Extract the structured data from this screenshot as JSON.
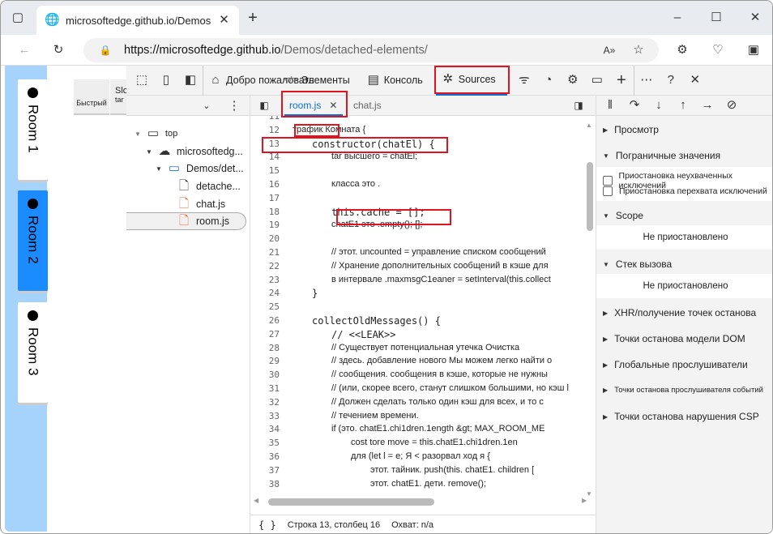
{
  "browser": {
    "tab_title": "microsoftedge.github.io/Demos/d",
    "url_host": "https://microsoftedge.github.io",
    "url_path": "/Demos/detached-elements/"
  },
  "page": {
    "rooms": [
      "Room 1",
      "Room 2",
      "Room 3"
    ],
    "buttons": {
      "fast": "Быстрый",
      "slow_top": "Slo",
      "slow": "tar"
    }
  },
  "devtools": {
    "tabs": {
      "welcome": "Добро пожаловать",
      "elements": "Элементы",
      "console": "Консоль",
      "sources": "Sources"
    },
    "tree": {
      "top": "top",
      "host": "microsoftedg...",
      "folder": "Demos/det...",
      "files": [
        "detache...",
        "chat.js",
        "room.js"
      ]
    },
    "editor_tabs": [
      "room.js",
      "chat.js"
    ],
    "code": [
      {
        "n": "11",
        "t": "",
        "c": ""
      },
      {
        "n": "12",
        "t": "трафик  Комната {",
        "c": "small"
      },
      {
        "n": "13",
        "t": "constructor(chatEl) {",
        "c": "mono",
        "i": 1
      },
      {
        "n": "14",
        "t": "tar высшего        = chatEl;",
        "c": "small",
        "i": 2
      },
      {
        "n": "15",
        "t": "",
        "c": ""
      },
      {
        "n": "16",
        "t": "класса это .",
        "c": "small",
        "i": 2
      },
      {
        "n": "17",
        "t": "",
        "c": ""
      },
      {
        "n": "18",
        "t": "this.cache = [];",
        "c": "mono",
        "i": 2
      },
      {
        "n": "19",
        "t": "chatE1 это .empty();    [];",
        "c": "small",
        "i": 2
      },
      {
        "n": "20",
        "t": "",
        "c": ""
      },
      {
        "n": "21",
        "t": "//  этот. uncounted = управление списком сообщений",
        "c": "small",
        "i": 2
      },
      {
        "n": "22",
        "t": "//  Хранение дополнительных сообщений в кэше для",
        "c": "small",
        "i": 2
      },
      {
        "n": "23",
        "t": "в интервале .maxmsgC1eaner = setInterval(this.collect",
        "c": "small",
        "i": 2
      },
      {
        "n": "24",
        "t": "}",
        "c": "mono",
        "i": 1
      },
      {
        "n": "25",
        "t": "",
        "c": ""
      },
      {
        "n": "26",
        "t": "collectOldMessages() {",
        "c": "mono",
        "i": 1
      },
      {
        "n": "27",
        "t": "// <<LEAK>>",
        "c": "cm",
        "i": 2
      },
      {
        "n": "28",
        "t": "//  Существует потенциальная утечка                     Очистка",
        "c": "small",
        "i": 2
      },
      {
        "n": "29",
        "t": "//  здесь. добавление нового                     Мы можем легко найти о",
        "c": "small",
        "i": 2
      },
      {
        "n": "30",
        "t": "//  сообщения. сообщения в кэше, которые не нужны",
        "c": "small",
        "i": 2
      },
      {
        "n": "31",
        "t": "//  (или, скорее всего, станут слишком большими, но кэш l",
        "c": "small",
        "i": 2
      },
      {
        "n": "32",
        "t": "//  Должен сделать только один кэш для всех, и то с",
        "c": "small",
        "i": 2
      },
      {
        "n": "33",
        "t": "//  течением времени.",
        "c": "small",
        "i": 2
      },
      {
        "n": "34",
        "t": "if    (это. chatE1.chi1dren.1ength &gt;              MAX_ROOM_ME",
        "c": "small",
        "i": 2
      },
      {
        "n": "35",
        "t": "cost tore move = this.chatE1.chi1dren.1en",
        "c": "small",
        "i": 3
      },
      {
        "n": "36",
        "t": "для (let l = e; Я < разорвал ход я {",
        "c": "small",
        "i": 3
      },
      {
        "n": "37",
        "t": "этот. тайник. push(this. chatE1. children [",
        "c": "small",
        "i": 4
      },
      {
        "n": "38",
        "t": "этот. chatE1. дети. remove();",
        "c": "small",
        "i": 4
      }
    ],
    "status": {
      "position": "Строка 13, столбец 16",
      "coverage": "Охват: n/a"
    },
    "debugger": {
      "watch": "Просмотр",
      "breakpoints": "Пограничные значения",
      "pause_uncaught": "Приостановка неухваченных исключений",
      "pause_caught": "Приостановка перехвата исключений",
      "scope": "Scope",
      "not_paused": "Не приостановлено",
      "call_stack": "Стек вызова",
      "not_paused2": "Не приостановлено",
      "xhr": "XHR/получение точек останова",
      "dom": "Точки останова модели DOM",
      "global": "Глобальные прослушиватели",
      "event": "Точки останова прослушивателя событий",
      "csp": "Точки останова нарушения CSP"
    }
  }
}
